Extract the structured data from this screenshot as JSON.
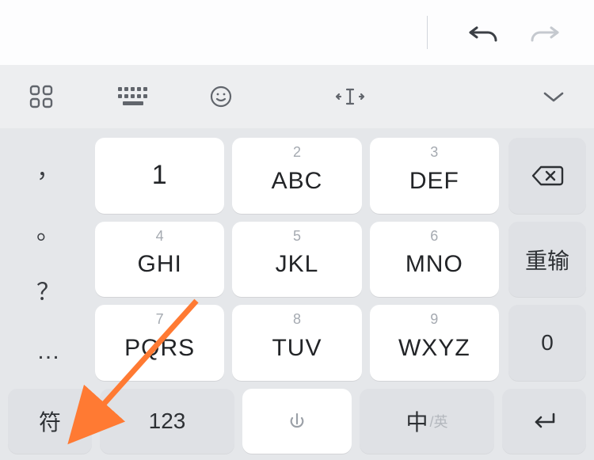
{
  "topbar": {
    "undo": "undo",
    "redo": "redo"
  },
  "iconrow": {
    "apps": "apps",
    "keyboard": "keyboard-layout",
    "emoji": "emoji",
    "cursor": "cursor-move",
    "collapse": "collapse"
  },
  "left_punct": {
    "p1": "，",
    "p2": "。",
    "p3": "？",
    "p4": "…"
  },
  "keys": [
    {
      "hint": "",
      "main": "1"
    },
    {
      "hint": "2",
      "main": "ABC"
    },
    {
      "hint": "3",
      "main": "DEF"
    },
    {
      "hint": "4",
      "main": "GHI"
    },
    {
      "hint": "5",
      "main": "JKL"
    },
    {
      "hint": "6",
      "main": "MNO"
    },
    {
      "hint": "7",
      "main": "PQRS"
    },
    {
      "hint": "8",
      "main": "TUV"
    },
    {
      "hint": "9",
      "main": "WXYZ"
    }
  ],
  "right": {
    "backspace": "⌫",
    "retype": "重输",
    "zero": "0"
  },
  "bottom": {
    "symbols": "符",
    "numeric": "123",
    "space": "space",
    "lang_primary": "中",
    "lang_secondary": "/英",
    "enter": "↵"
  },
  "annotation": {
    "arrow_target": "symbols-key"
  }
}
